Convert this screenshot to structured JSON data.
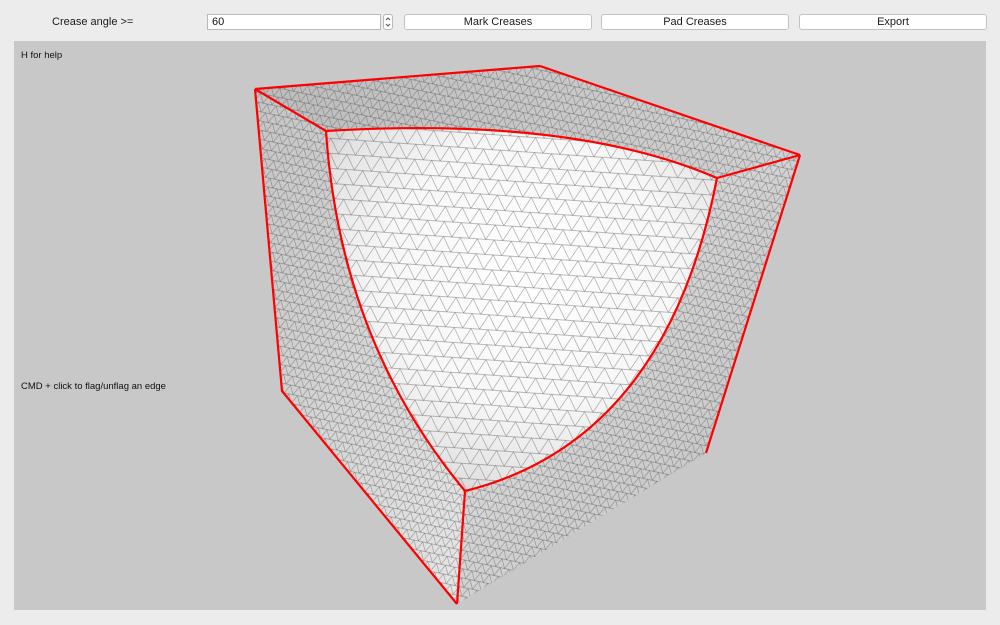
{
  "toolbar": {
    "crease_label": "Crease angle >=",
    "crease_value": "60",
    "mark_label": "Mark Creases",
    "pad_label": "Pad Creases",
    "export_label": "Export"
  },
  "viewport": {
    "help_hint": "H for help",
    "cmd_hint": "CMD + click to flag/unflag an edge"
  },
  "colors": {
    "crease": "#ff0000",
    "background": "#c8c8c8",
    "face_light": "#f4f4f4",
    "face_shaded": "#c9c9c9",
    "mesh_line": "#3a3a3a"
  }
}
